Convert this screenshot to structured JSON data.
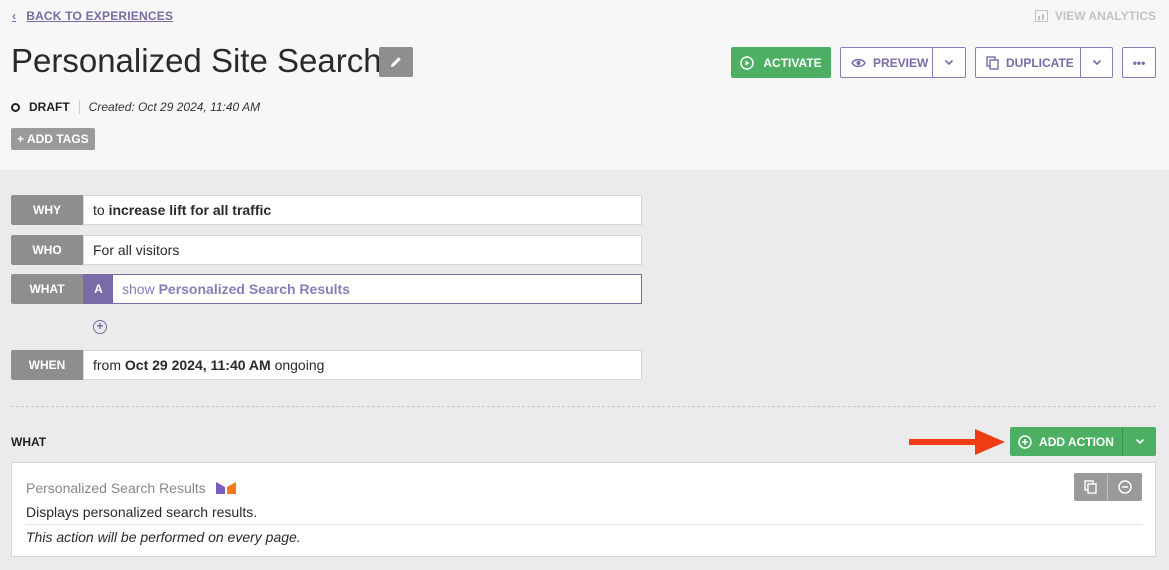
{
  "nav": {
    "back_chevron": "‹",
    "back_label": "BACK TO EXPERIENCES",
    "view_analytics_label": "VIEW ANALYTICS"
  },
  "header": {
    "title": "Personalized Site Search",
    "status": "DRAFT",
    "created": "Created: Oct 29 2024, 11:40 AM",
    "add_tags_label": "+ ADD TAGS"
  },
  "toolbar": {
    "activate_label": "ACTIVATE",
    "preview_label": "PREVIEW",
    "duplicate_label": "DUPLICATE",
    "more_label": "•••"
  },
  "rules": {
    "why": {
      "label": "WHY",
      "prefix": "to ",
      "value": "increase lift for all traffic"
    },
    "who": {
      "label": "WHO",
      "value": "For all visitors"
    },
    "what": {
      "label": "WHAT",
      "variant": "A",
      "prefix": "show ",
      "value": "Personalized Search Results"
    },
    "add_symbol": "+",
    "when": {
      "label": "WHEN",
      "prefix": "from ",
      "value": "Oct 29 2024, 11:40 AM",
      "suffix": " ongoing"
    }
  },
  "what_section": {
    "heading": "WHAT",
    "add_action_label": "ADD ACTION",
    "card": {
      "name": "Personalized Search Results",
      "description": "Displays personalized search results.",
      "note": "This action will be performed on every page."
    }
  },
  "colors": {
    "accent_purple": "#7a6aa8",
    "success_green": "#4caf63",
    "arrow_red": "#f03c14",
    "label_gray": "#8e8e8e"
  },
  "icons": [
    "chevron-left-icon",
    "analytics-icon",
    "pencil-icon",
    "play-circle-icon",
    "eye-icon",
    "chevron-down-icon",
    "copy-icon",
    "more-icon",
    "plus-circle-icon",
    "arrow-right-icon",
    "brand-logo-icon",
    "remove-icon"
  ]
}
